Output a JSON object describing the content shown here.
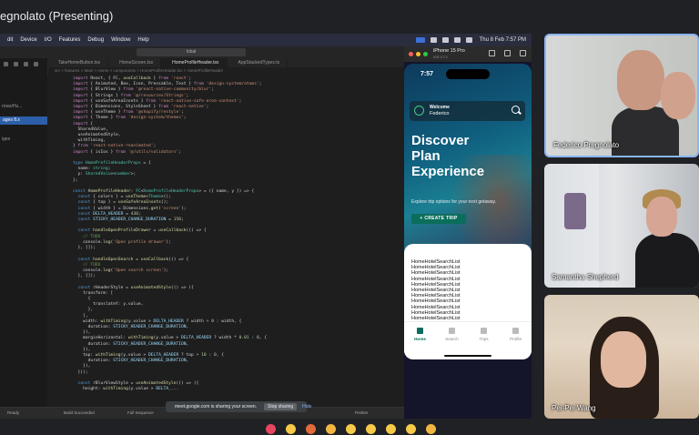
{
  "meet": {
    "title": "egnolato (Presenting)"
  },
  "mac_menu": [
    "dit",
    "Device",
    "I/O",
    "Features",
    "Debug",
    "Window",
    "Help"
  ],
  "mac_status": {
    "date_time": "Thu 8 Feb 7:57 PM"
  },
  "editor": {
    "search_text": "lobal",
    "sidebar_selected": "ages 8.x",
    "sidebar_label_2": "rows/Hu...",
    "sidebar_label_3": "iges",
    "tabs": [
      "TakeHomeButton.tsx",
      "HomeScreen.tsx",
      "HomeProfileHeader.tsx",
      "AppStackedTypes.ts"
    ],
    "breadcrumb": "src > features > Main > Home > components > HomeProfileHeader.tsx > HomeProfileHeader"
  },
  "simulator": {
    "device": "iPhone 15 Pro",
    "os": "iOS 17.2",
    "time": "7:57",
    "welcome": "Welcome",
    "user": "Federico",
    "hero": "Discover\nPlan\nExperience",
    "subline": "Explore trip options for your next getaway.",
    "create_trip": "+ CREATE TRIP",
    "list_label": "HomeHotelSearchList",
    "tabs": [
      "Home",
      "Search",
      "Trips",
      "Profile"
    ]
  },
  "share_banner": {
    "message": "meet.google.com is sharing your screen.",
    "stop": "Stop sharing",
    "hide": "Hide"
  },
  "status_bar": [
    "Ready",
    "Build Succeeded",
    "Full Sequence",
    "Prettier"
  ],
  "participants": [
    {
      "name": "Federico Pregnolato",
      "active": true
    },
    {
      "name": "Samantha Shepherd",
      "active": false
    },
    {
      "name": "Pei-Pei Wang",
      "active": false
    }
  ],
  "reactions": [
    {
      "icon": "heart-icon",
      "color": "#e84560"
    },
    {
      "icon": "thumbs-up-icon",
      "color": "#f7c948"
    },
    {
      "icon": "party-popper-icon",
      "color": "#e06b3a"
    },
    {
      "icon": "clapping-hands-icon",
      "color": "#f2b640"
    },
    {
      "icon": "laughing-face-icon",
      "color": "#f7c948"
    },
    {
      "icon": "surprised-face-icon",
      "color": "#f7c948"
    },
    {
      "icon": "crying-face-icon",
      "color": "#f7c948"
    },
    {
      "icon": "thinking-face-icon",
      "color": "#f7c948"
    },
    {
      "icon": "thumbs-down-icon",
      "color": "#f2b640"
    }
  ]
}
